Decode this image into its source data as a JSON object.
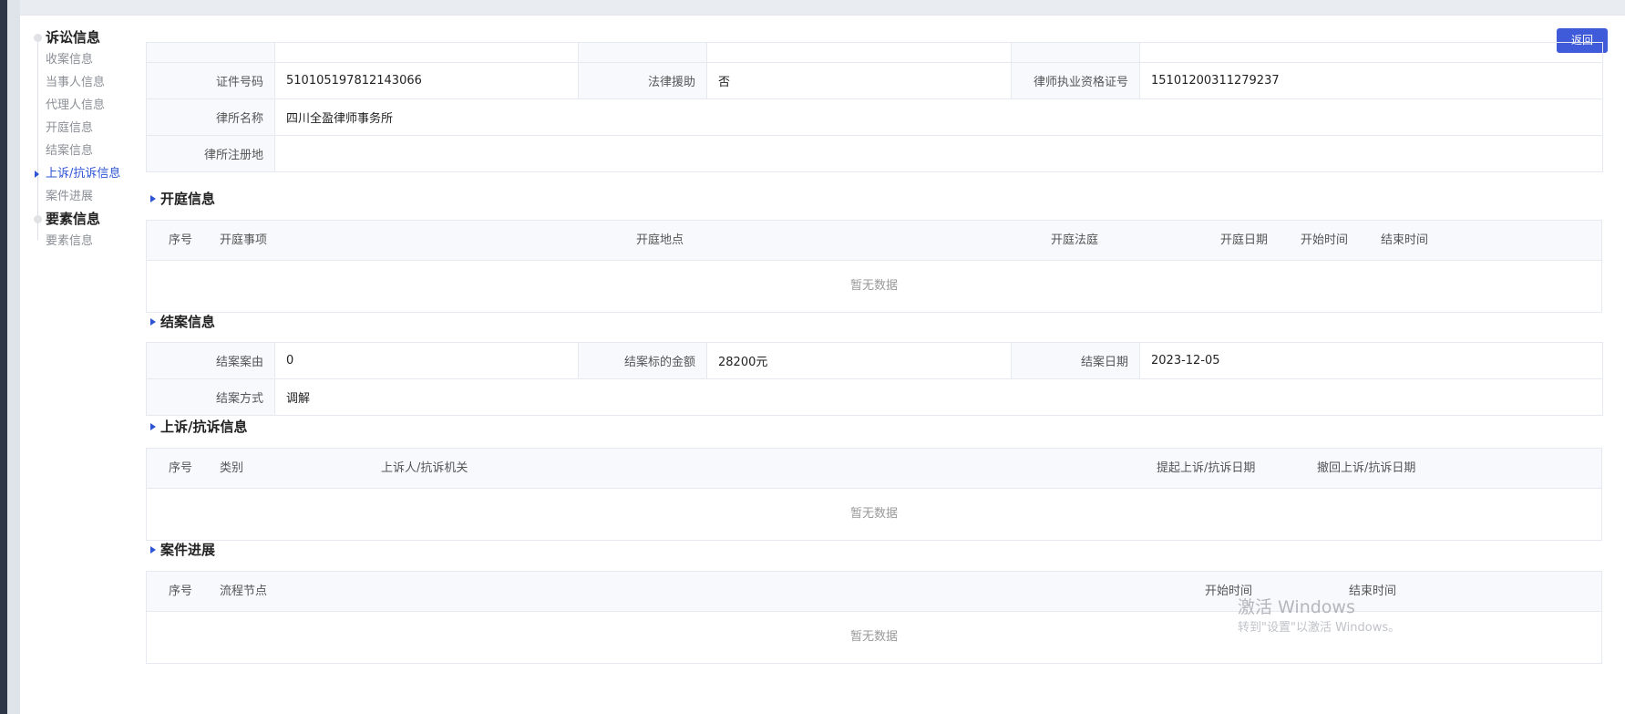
{
  "sidebar": {
    "groups": [
      {
        "title": "诉讼信息",
        "items": [
          "收案信息",
          "当事人信息",
          "代理人信息",
          "开庭信息",
          "结案信息",
          "上诉/抗诉信息",
          "案件进展"
        ]
      },
      {
        "title": "要素信息",
        "items": [
          "要素信息"
        ]
      }
    ],
    "active_item": "上诉/抗诉信息"
  },
  "header": {
    "back_label": "返回"
  },
  "agent_info": {
    "id_label": "证件号码",
    "id_value": "510105197812143066",
    "legal_aid_label": "法律援助",
    "legal_aid_value": "否",
    "license_label": "律师执业资格证号",
    "license_value": "15101200311279237",
    "firm_label": "律所名称",
    "firm_value": "四川全盈律师事务所",
    "firm_address_label": "律所注册地",
    "firm_address_value": ""
  },
  "hearing": {
    "title": "开庭信息",
    "columns": [
      "序号",
      "开庭事项",
      "开庭地点",
      "开庭法庭",
      "开庭日期",
      "开始时间",
      "结束时间"
    ],
    "empty": "暂无数据"
  },
  "closing": {
    "title": "结案信息",
    "cause_label": "结案案由",
    "cause_value": "0",
    "amount_label": "结案标的金额",
    "amount_value": "28200元",
    "date_label": "结案日期",
    "date_value": "2023-12-05",
    "method_label": "结案方式",
    "method_value": "调解"
  },
  "appeal": {
    "title": "上诉/抗诉信息",
    "columns": [
      "序号",
      "类别",
      "上诉人/抗诉机关",
      "提起上诉/抗诉日期",
      "撤回上诉/抗诉日期"
    ],
    "empty": "暂无数据"
  },
  "progress": {
    "title": "案件进展",
    "columns": [
      "序号",
      "流程节点",
      "开始时间",
      "结束时间"
    ],
    "empty": "暂无数据"
  },
  "watermark": {
    "line1": "激活 Windows",
    "line2": "转到\"设置\"以激活 Windows。"
  },
  "colors": {
    "accent": "#2e54d6",
    "button": "#3f5bd9"
  }
}
